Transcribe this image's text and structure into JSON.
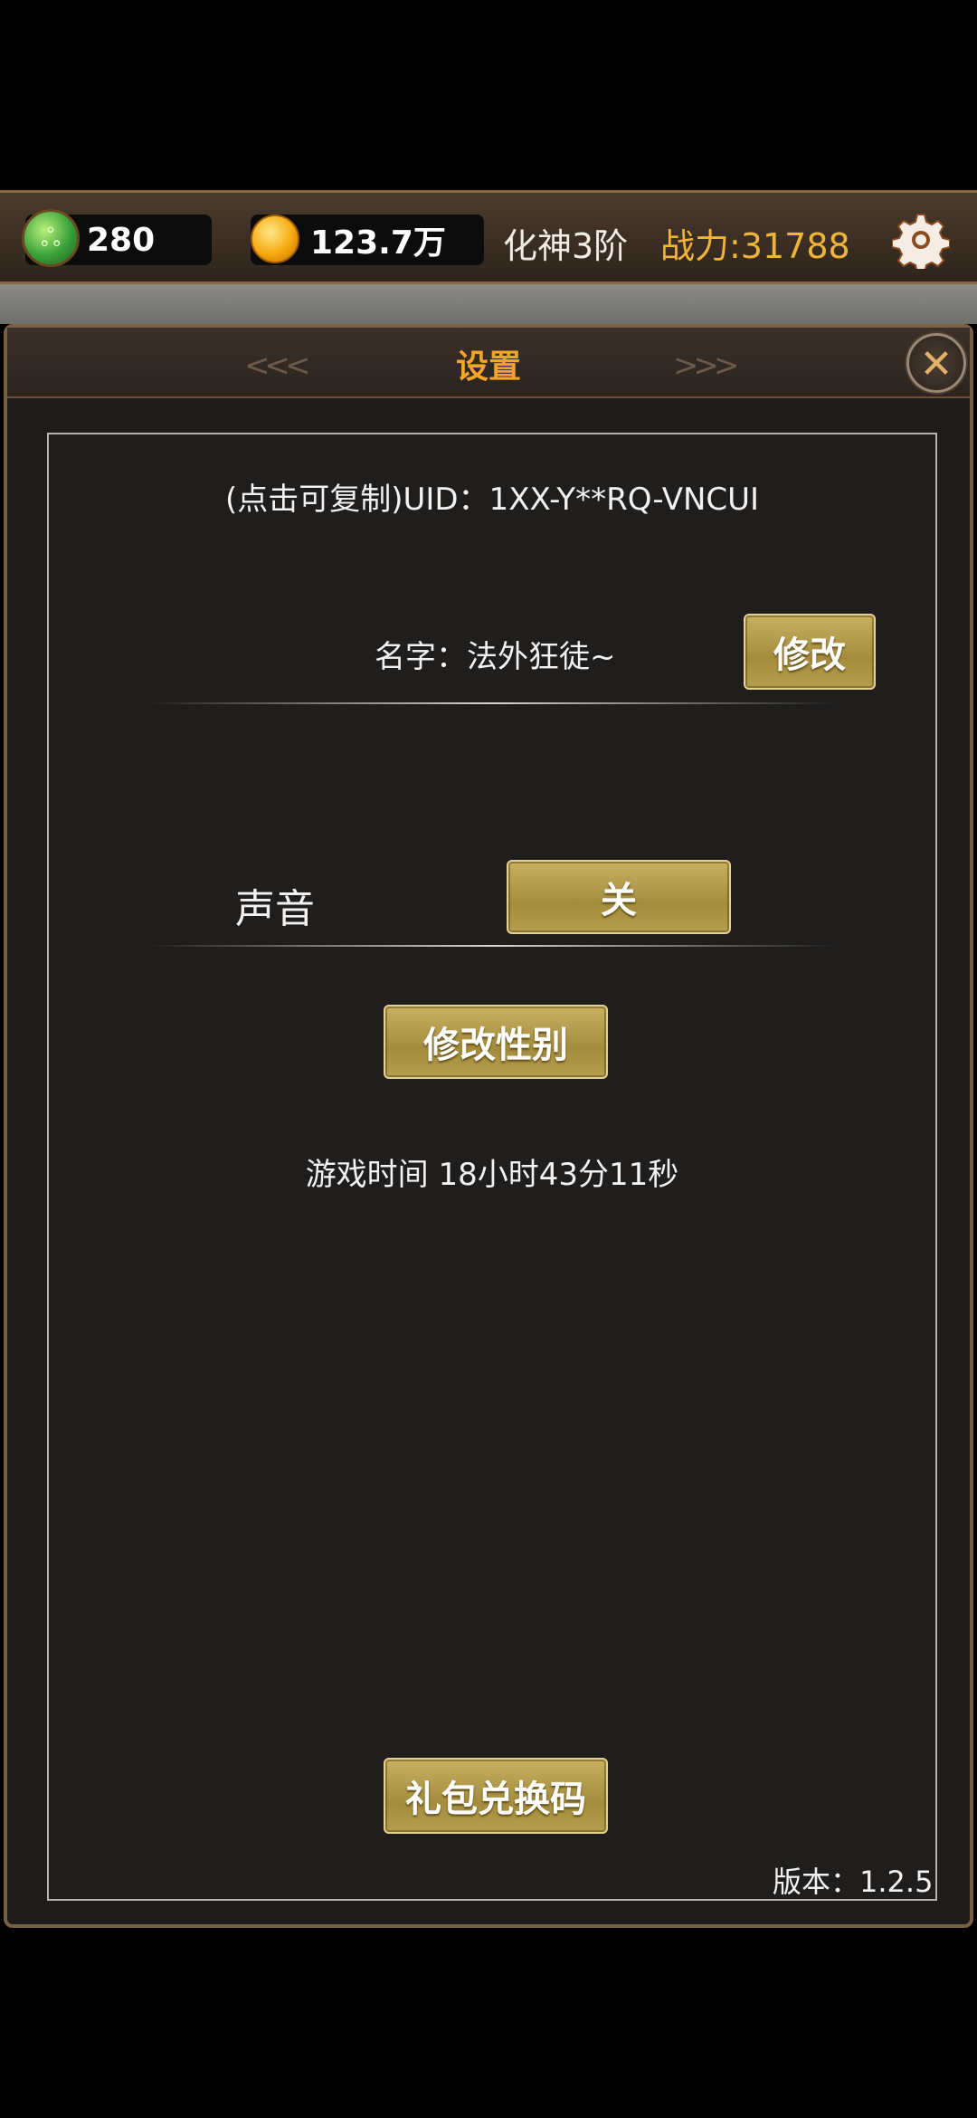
{
  "topbar": {
    "jade_count": "280",
    "gold_amount": "123.7万",
    "realm": "化神3阶",
    "power": "战力:31788"
  },
  "panel": {
    "title": "设置",
    "uid_text": "(点击可复制)UID：1XX-Y**RQ-VNCUI",
    "name_text": "名字：法外狂徒~",
    "edit_button": "修改",
    "sound_label": "声音",
    "sound_button": "关",
    "gender_button": "修改性别",
    "playtime_text": "游戏时间 18小时43分11秒",
    "gift_code_button": "礼包兑换码",
    "version_text": "版本：1.2.5"
  },
  "colors": {
    "title_orange": "#f3a52a",
    "power_gold": "#f0b43b",
    "button_gold": "#b09848"
  },
  "icons": {
    "jade": "jade-currency-icon",
    "gold": "gold-coin-icon",
    "settings": "gear-icon",
    "close": "close-icon"
  }
}
